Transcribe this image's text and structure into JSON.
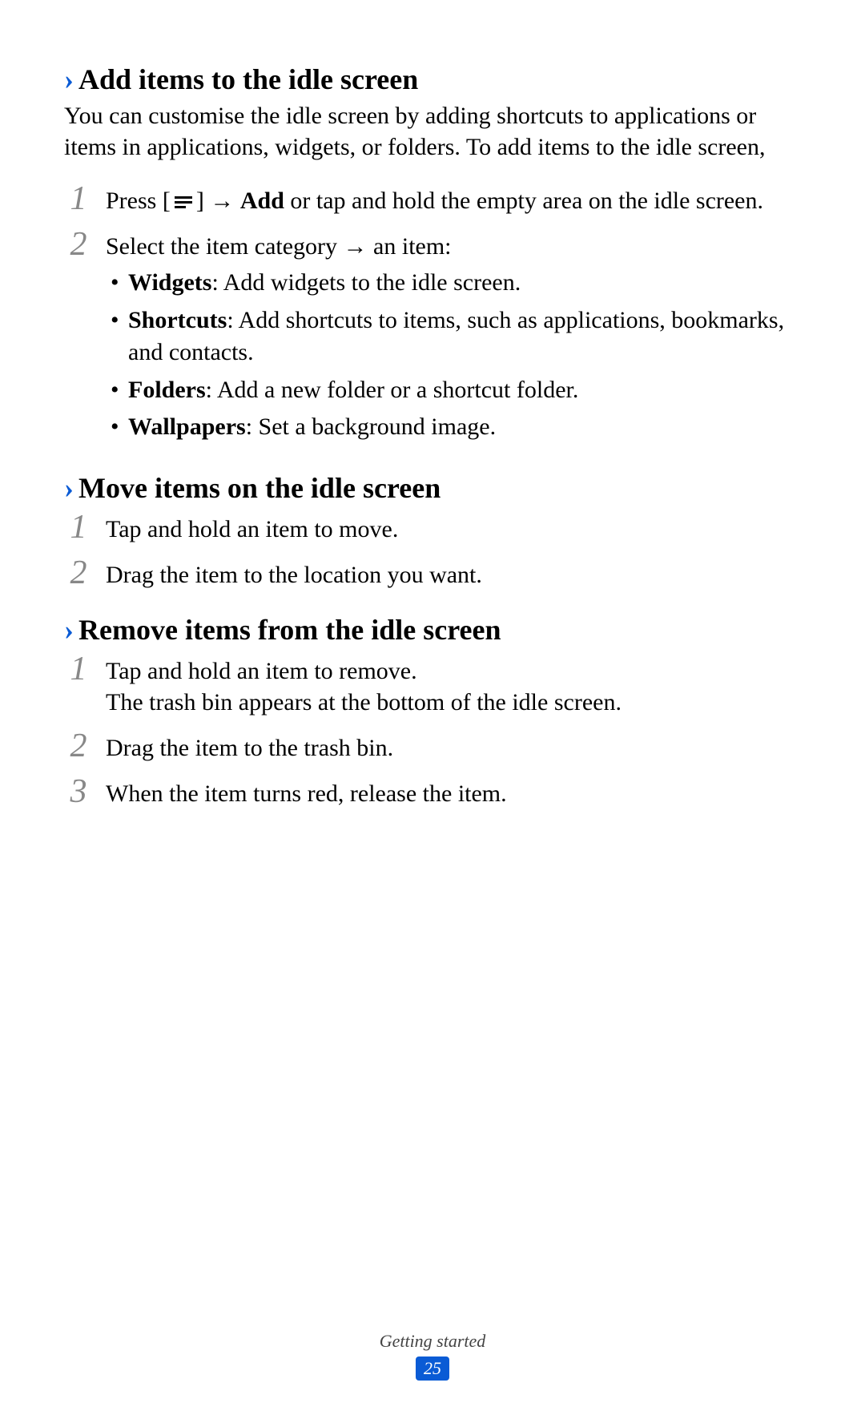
{
  "sections": {
    "add": {
      "heading": "Add items to the idle screen",
      "intro": "You can customise the idle screen by adding shortcuts to applications or items in applications, widgets, or folders. To add items to the idle screen,",
      "steps": {
        "s1": {
          "num": "1",
          "pre": "Press [",
          "mid": "] → ",
          "bold": "Add",
          "post": " or tap and hold the empty area on the idle screen."
        },
        "s2": {
          "num": "2",
          "text": "Select the item category → an item:",
          "bullets": {
            "b1": {
              "label": "Widgets",
              "text": ": Add widgets to the idle screen."
            },
            "b2": {
              "label": "Shortcuts",
              "text": ": Add shortcuts to items, such as applications, bookmarks, and contacts."
            },
            "b3": {
              "label": "Folders",
              "text": ": Add a new folder or a shortcut folder."
            },
            "b4": {
              "label": "Wallpapers",
              "text": ": Set a background image."
            }
          }
        }
      }
    },
    "move": {
      "heading": "Move items on the idle screen",
      "steps": {
        "s1": {
          "num": "1",
          "text": "Tap and hold an item to move."
        },
        "s2": {
          "num": "2",
          "text": "Drag the item to the location you want."
        }
      }
    },
    "remove": {
      "heading": "Remove items from the idle screen",
      "steps": {
        "s1": {
          "num": "1",
          "line1": "Tap and hold an item to remove.",
          "line2": "The trash bin appears at the bottom of the idle screen."
        },
        "s2": {
          "num": "2",
          "text": "Drag the item to the trash bin."
        },
        "s3": {
          "num": "3",
          "text": "When the item turns red, release the item."
        }
      }
    }
  },
  "footer": {
    "section": "Getting started",
    "page": "25"
  }
}
